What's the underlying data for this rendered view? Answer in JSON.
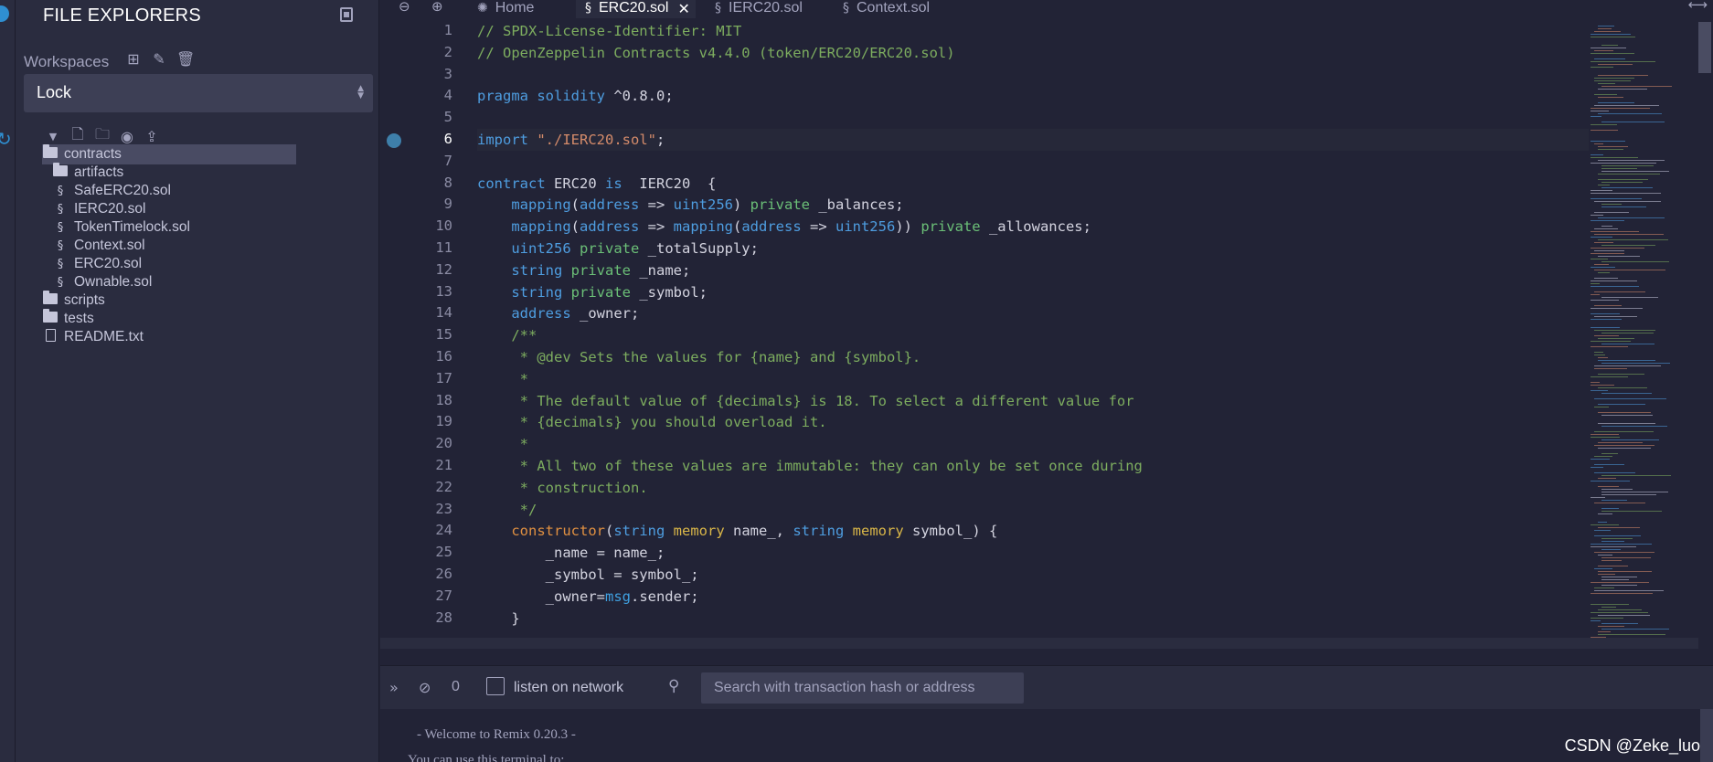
{
  "panel": {
    "title": "FILE EXPLORERS",
    "workspaces_label": "Workspaces",
    "workspace_selected": "Lock"
  },
  "tree": {
    "items": [
      {
        "label": "contracts",
        "type": "folder-open",
        "level": 0
      },
      {
        "label": "artifacts",
        "type": "folder",
        "level": 1
      },
      {
        "label": "SafeERC20.sol",
        "type": "sol",
        "level": 1
      },
      {
        "label": "IERC20.sol",
        "type": "sol",
        "level": 1
      },
      {
        "label": "TokenTimelock.sol",
        "type": "sol",
        "level": 1
      },
      {
        "label": "Context.sol",
        "type": "sol",
        "level": 1
      },
      {
        "label": "ERC20.sol",
        "type": "sol",
        "level": 1
      },
      {
        "label": "Ownable.sol",
        "type": "sol",
        "level": 1
      },
      {
        "label": "scripts",
        "type": "folder",
        "level": 0
      },
      {
        "label": "tests",
        "type": "folder",
        "level": 0
      },
      {
        "label": "README.txt",
        "type": "file",
        "level": 0
      }
    ]
  },
  "tabs": [
    {
      "label": "Home",
      "active": false
    },
    {
      "label": "ERC20.sol",
      "active": true
    },
    {
      "label": "IERC20.sol",
      "active": false
    },
    {
      "label": "Context.sol",
      "active": false
    }
  ],
  "editor": {
    "current_line": 6,
    "lines": [
      [
        [
          "c",
          "// SPDX-License-Identifier: MIT"
        ]
      ],
      [
        [
          "c",
          "// OpenZeppelin Contracts v4.4.0 (token/ERC20/ERC20.sol)"
        ]
      ],
      [],
      [
        [
          "k",
          "pragma"
        ],
        [
          "p",
          " "
        ],
        [
          "k",
          "solidity"
        ],
        [
          "p",
          " ^0.8.0;"
        ]
      ],
      [],
      [
        [
          "k",
          "import"
        ],
        [
          "p",
          " "
        ],
        [
          "s",
          "\"./IERC20.sol\""
        ],
        [
          "p",
          ";"
        ]
      ],
      [],
      [
        [
          "k",
          "contract"
        ],
        [
          "p",
          " ERC20 "
        ],
        [
          "k",
          "is"
        ],
        [
          "p",
          "  IERC20  {"
        ]
      ],
      [
        [
          "p",
          "    "
        ],
        [
          "k",
          "mapping"
        ],
        [
          "p",
          "("
        ],
        [
          "k",
          "address"
        ],
        [
          "p",
          " => "
        ],
        [
          "k",
          "uint256"
        ],
        [
          "p",
          ") "
        ],
        [
          "g",
          "private"
        ],
        [
          "p",
          " _balances;"
        ]
      ],
      [
        [
          "p",
          "    "
        ],
        [
          "k",
          "mapping"
        ],
        [
          "p",
          "("
        ],
        [
          "k",
          "address"
        ],
        [
          "p",
          " => "
        ],
        [
          "k",
          "mapping"
        ],
        [
          "p",
          "("
        ],
        [
          "k",
          "address"
        ],
        [
          "p",
          " => "
        ],
        [
          "k",
          "uint256"
        ],
        [
          "p",
          ")) "
        ],
        [
          "g",
          "private"
        ],
        [
          "p",
          " _allowances;"
        ]
      ],
      [
        [
          "p",
          "    "
        ],
        [
          "k",
          "uint256"
        ],
        [
          "p",
          " "
        ],
        [
          "g",
          "private"
        ],
        [
          "p",
          " _totalSupply;"
        ]
      ],
      [
        [
          "p",
          "    "
        ],
        [
          "k",
          "string"
        ],
        [
          "p",
          " "
        ],
        [
          "g",
          "private"
        ],
        [
          "p",
          " _name;"
        ]
      ],
      [
        [
          "p",
          "    "
        ],
        [
          "k",
          "string"
        ],
        [
          "p",
          " "
        ],
        [
          "g",
          "private"
        ],
        [
          "p",
          " _symbol;"
        ]
      ],
      [
        [
          "p",
          "    "
        ],
        [
          "k",
          "address"
        ],
        [
          "p",
          " _owner;"
        ]
      ],
      [
        [
          "p",
          "    "
        ],
        [
          "c",
          "/**"
        ]
      ],
      [
        [
          "p",
          "     "
        ],
        [
          "c",
          "* @dev Sets the values for {name} and {symbol}."
        ]
      ],
      [
        [
          "p",
          "     "
        ],
        [
          "c",
          "*"
        ]
      ],
      [
        [
          "p",
          "     "
        ],
        [
          "c",
          "* The default value of {decimals} is 18. To select a different value for"
        ]
      ],
      [
        [
          "p",
          "     "
        ],
        [
          "c",
          "* {decimals} you should overload it."
        ]
      ],
      [
        [
          "p",
          "     "
        ],
        [
          "c",
          "*"
        ]
      ],
      [
        [
          "p",
          "     "
        ],
        [
          "c",
          "* All two of these values are immutable: they can only be set once during"
        ]
      ],
      [
        [
          "p",
          "     "
        ],
        [
          "c",
          "* construction."
        ]
      ],
      [
        [
          "p",
          "     "
        ],
        [
          "c",
          "*/"
        ]
      ],
      [
        [
          "p",
          "    "
        ],
        [
          "r",
          "constructor"
        ],
        [
          "p",
          "("
        ],
        [
          "k",
          "string"
        ],
        [
          "p",
          " "
        ],
        [
          "y",
          "memory"
        ],
        [
          "p",
          " name_, "
        ],
        [
          "k",
          "string"
        ],
        [
          "p",
          " "
        ],
        [
          "y",
          "memory"
        ],
        [
          "p",
          " symbol_) {"
        ]
      ],
      [
        [
          "p",
          "        _name = name_;"
        ]
      ],
      [
        [
          "p",
          "        _symbol = symbol_;"
        ]
      ],
      [
        [
          "p",
          "        _owner="
        ],
        [
          "b",
          "msg"
        ],
        [
          "p",
          ".sender;"
        ]
      ],
      [
        [
          "p",
          "    }"
        ]
      ]
    ]
  },
  "terminal": {
    "count": "0",
    "listen_label": "listen on network",
    "search_placeholder": "Search with transaction hash or address",
    "lines": [
      "- Welcome to Remix 0.20.3 -",
      "You can use this terminal to:"
    ]
  },
  "watermark": "CSDN @Zeke_luo",
  "colors": {
    "background": "#222336",
    "panel": "#2a2c3f",
    "comment": "#7dad5f",
    "keyword": "#4e9de0",
    "string": "#d48b6a"
  }
}
